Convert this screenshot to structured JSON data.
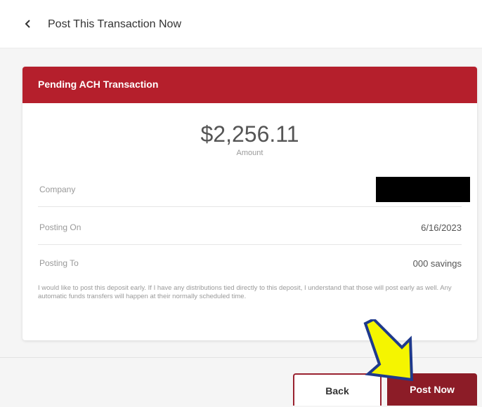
{
  "header": {
    "title": "Post This Transaction Now",
    "back_icon": "chevron-left-icon"
  },
  "card": {
    "title": "Pending ACH Transaction",
    "amount": "$2,256.11",
    "amount_label": "Amount",
    "rows": [
      {
        "label": "Company",
        "value": ""
      },
      {
        "label": "Posting On",
        "value": "6/16/2023"
      },
      {
        "label": "Posting To",
        "value": "000 savings"
      }
    ],
    "disclaimer": "I would like to post this deposit early. If I have any distributions tied directly to this deposit, I understand that those will post early as well. Any automatic funds transfers will happen at their normally scheduled time."
  },
  "footer": {
    "back_label": "Back",
    "post_label": "Post Now"
  },
  "colors": {
    "brand_red": "#b51f2c",
    "button_dark_red": "#8c1c27",
    "arrow_yellow": "#f5f500",
    "arrow_outline": "#1f3a8c"
  }
}
